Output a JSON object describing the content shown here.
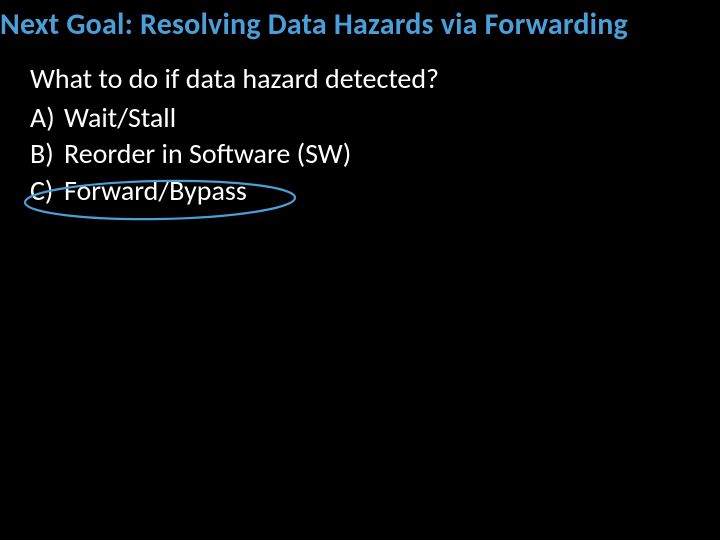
{
  "title": "Next Goal: Resolving Data Hazards via Forwarding",
  "question": "What to do if data hazard detected?",
  "options": [
    {
      "letter": "A)",
      "text": "Wait/Stall"
    },
    {
      "letter": "B)",
      "text": "Reorder in Software (SW)"
    },
    {
      "letter": "C)",
      "text": "Forward/Bypass"
    }
  ],
  "annotation_color": "#4a9fd8"
}
